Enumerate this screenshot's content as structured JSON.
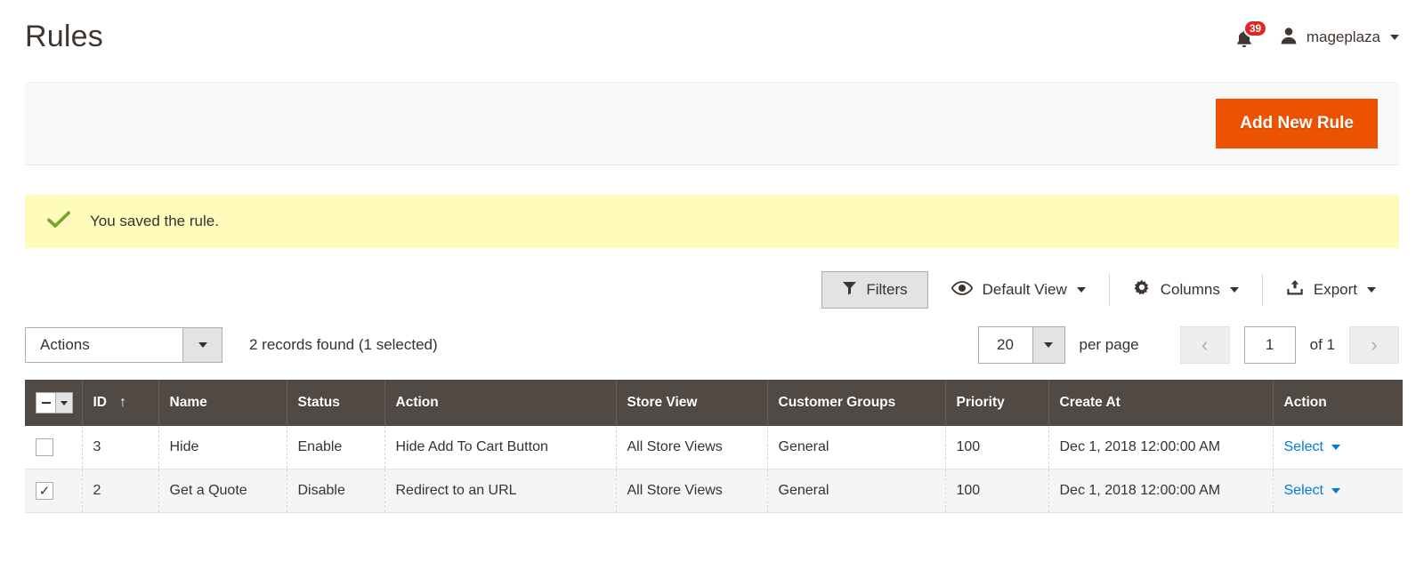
{
  "header": {
    "title": "Rules",
    "notifications_count": "39",
    "user_name": "mageplaza"
  },
  "page_actions": {
    "add_new_rule": "Add New Rule"
  },
  "message": {
    "text": "You saved the rule.",
    "type": "success",
    "background": "#fffbbb",
    "icon_color": "#79a22e"
  },
  "toolbar": {
    "filters": "Filters",
    "view": "Default View",
    "columns": "Columns",
    "export": "Export"
  },
  "grid_controls": {
    "actions_label": "Actions",
    "records_found": "2 records found (1 selected)",
    "per_page_value": "20",
    "per_page_label": "per page",
    "page_value": "1",
    "page_of": "of 1",
    "prev_symbol": "‹",
    "next_symbol": "›"
  },
  "grid": {
    "columns": [
      {
        "label": "",
        "key": "checkbox"
      },
      {
        "label": "ID",
        "key": "id",
        "sort": "↑"
      },
      {
        "label": "Name",
        "key": "name"
      },
      {
        "label": "Status",
        "key": "status"
      },
      {
        "label": "Action",
        "key": "action"
      },
      {
        "label": "Store View",
        "key": "store_view"
      },
      {
        "label": "Customer Groups",
        "key": "customer_groups"
      },
      {
        "label": "Priority",
        "key": "priority"
      },
      {
        "label": "Create At",
        "key": "create_at"
      },
      {
        "label": "Action",
        "key": "row_action"
      }
    ],
    "rows": [
      {
        "selected": false,
        "id": "3",
        "name": "Hide",
        "status": "Enable",
        "action": "Hide Add To Cart Button",
        "store_view": "All Store Views",
        "customer_groups": "General",
        "priority": "100",
        "create_at": "Dec 1, 2018 12:00:00 AM",
        "row_action": "Select"
      },
      {
        "selected": true,
        "id": "2",
        "name": "Get a Quote",
        "status": "Disable",
        "action": "Redirect to an URL",
        "store_view": "All Store Views",
        "customer_groups": "General",
        "priority": "100",
        "create_at": "Dec 1, 2018 12:00:00 AM",
        "row_action": "Select"
      }
    ]
  },
  "colors": {
    "primary_button": "#eb5202",
    "grid_header": "#514943",
    "link": "#007bdb",
    "badge": "#e22626"
  }
}
